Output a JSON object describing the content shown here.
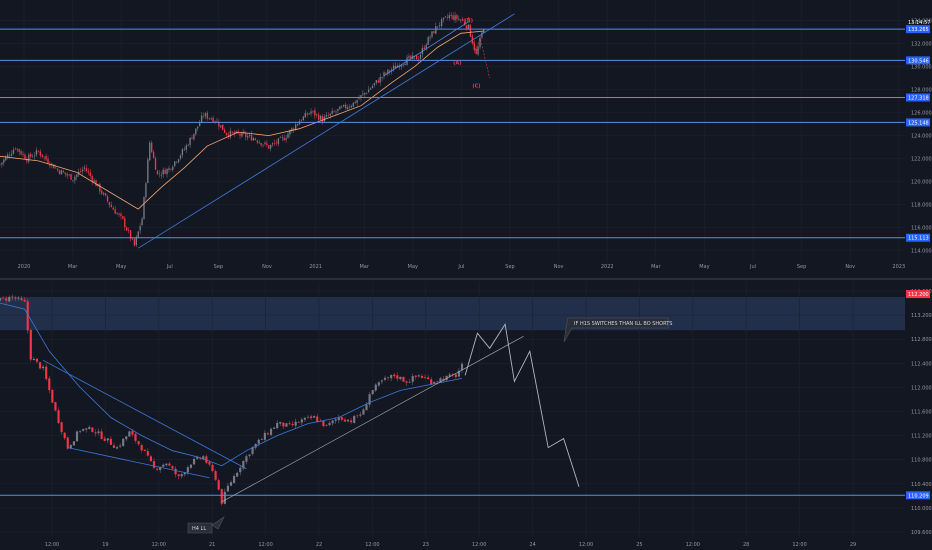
{
  "colors": {
    "background": "#131722",
    "grid": "#1e222d",
    "level_line": "#2962ff",
    "level_line_soft": "#5b8def",
    "badge_bg": "#2962ff",
    "up_candle": "#787b86",
    "down_candle": "#f23645",
    "ma_orange": "#f5a66e",
    "ma_blue": "#3d7bd9",
    "projection": "#b2b5be",
    "zone": "#2a3a5c",
    "price_badge_red": "#f23645"
  },
  "chart_data": [
    {
      "type": "candlestick",
      "panel": "top",
      "timeframe": "daily",
      "x_tick_labels": [
        "2020",
        "Mar",
        "May",
        "Jul",
        "Sep",
        "Nov",
        "2021",
        "Mar",
        "May",
        "Jul",
        "Sep",
        "Nov",
        "2022",
        "Mar",
        "May",
        "Jul",
        "Sep",
        "Nov",
        "2023"
      ],
      "y_tick_labels": [
        "114.000",
        "116.000",
        "118.000",
        "120.000",
        "122.000",
        "124.000",
        "126.000",
        "128.000",
        "130.000",
        "132.000",
        "134.000"
      ],
      "ylim": [
        113.0,
        135.8
      ],
      "current_price_label": "133.265",
      "countdown_label": "13:14:57",
      "horizontal_levels": [
        {
          "value": 133.265,
          "label": "133.265"
        },
        {
          "value": 130.546,
          "label": "130.546"
        },
        {
          "value": 127.318,
          "label": "127.318"
        },
        {
          "value": 125.148,
          "label": "125.148"
        },
        {
          "value": 115.113,
          "label": "115.113"
        }
      ],
      "wave_labels": [
        "(B)",
        "(A)",
        "(C)"
      ],
      "path_points": [
        {
          "x": 0,
          "y": 121.5
        },
        {
          "x": 8,
          "y": 123.0
        },
        {
          "x": 14,
          "y": 122.0
        },
        {
          "x": 20,
          "y": 122.6
        },
        {
          "x": 30,
          "y": 121.0
        },
        {
          "x": 38,
          "y": 120.3
        },
        {
          "x": 44,
          "y": 121.2
        },
        {
          "x": 52,
          "y": 119.3
        },
        {
          "x": 58,
          "y": 117.8
        },
        {
          "x": 64,
          "y": 116.6
        },
        {
          "x": 70,
          "y": 114.4
        },
        {
          "x": 74,
          "y": 116.8
        },
        {
          "x": 78,
          "y": 123.4
        },
        {
          "x": 82,
          "y": 120.6
        },
        {
          "x": 88,
          "y": 121.1
        },
        {
          "x": 96,
          "y": 122.8
        },
        {
          "x": 102,
          "y": 124.5
        },
        {
          "x": 106,
          "y": 125.8
        },
        {
          "x": 112,
          "y": 125.4
        },
        {
          "x": 118,
          "y": 124.2
        },
        {
          "x": 124,
          "y": 124.1
        },
        {
          "x": 132,
          "y": 123.8
        },
        {
          "x": 140,
          "y": 123.0
        },
        {
          "x": 148,
          "y": 123.8
        },
        {
          "x": 156,
          "y": 125.3
        },
        {
          "x": 162,
          "y": 126.1
        },
        {
          "x": 168,
          "y": 125.4
        },
        {
          "x": 176,
          "y": 126.2
        },
        {
          "x": 184,
          "y": 126.8
        },
        {
          "x": 192,
          "y": 128.0
        },
        {
          "x": 200,
          "y": 129.3
        },
        {
          "x": 206,
          "y": 130.0
        },
        {
          "x": 212,
          "y": 130.6
        },
        {
          "x": 218,
          "y": 130.8
        },
        {
          "x": 222,
          "y": 132.1
        },
        {
          "x": 228,
          "y": 133.6
        },
        {
          "x": 234,
          "y": 134.4
        },
        {
          "x": 240,
          "y": 134.1
        },
        {
          "x": 244,
          "y": 133.4
        },
        {
          "x": 248,
          "y": 131.0
        },
        {
          "x": 252,
          "y": 133.5
        }
      ],
      "moving_average": [
        {
          "x": 0,
          "y": 122.2
        },
        {
          "x": 20,
          "y": 121.8
        },
        {
          "x": 40,
          "y": 120.8
        },
        {
          "x": 60,
          "y": 118.8
        },
        {
          "x": 72,
          "y": 117.6
        },
        {
          "x": 84,
          "y": 119.5
        },
        {
          "x": 96,
          "y": 121.2
        },
        {
          "x": 108,
          "y": 123.1
        },
        {
          "x": 124,
          "y": 124.3
        },
        {
          "x": 140,
          "y": 124.0
        },
        {
          "x": 156,
          "y": 124.6
        },
        {
          "x": 172,
          "y": 125.6
        },
        {
          "x": 188,
          "y": 126.6
        },
        {
          "x": 204,
          "y": 128.6
        },
        {
          "x": 216,
          "y": 130.0
        },
        {
          "x": 228,
          "y": 131.7
        },
        {
          "x": 240,
          "y": 132.9
        },
        {
          "x": 252,
          "y": 133.1
        }
      ]
    },
    {
      "type": "candlestick",
      "panel": "bottom",
      "timeframe": "intraday",
      "x_tick_labels": [
        "12:00",
        "19",
        "12:00",
        "21",
        "12:00",
        "22",
        "12:00",
        "23",
        "12:00",
        "24",
        "12:00",
        "25",
        "12:00",
        "28",
        "12:00",
        "29"
      ],
      "y_tick_labels": [
        "109.600",
        "110.000",
        "110.400",
        "110.800",
        "111.200",
        "111.600",
        "112.000",
        "112.400",
        "112.800",
        "113.200",
        "113.600"
      ],
      "ylim": [
        109.5,
        113.75
      ],
      "current_price_label": "112.200",
      "support_level": {
        "value": 110.209,
        "label": "110.209"
      },
      "resistance_zone": [
        112.95,
        113.5
      ],
      "annotations": [
        {
          "text": "IF H1S SWITCHES THAN ILL BO SHORTS",
          "style": "callout"
        },
        {
          "text": "H4 LL",
          "style": "callout"
        }
      ],
      "path_points": [
        {
          "x": 0,
          "y": 113.45
        },
        {
          "x": 4,
          "y": 113.5
        },
        {
          "x": 8,
          "y": 113.4
        },
        {
          "x": 10,
          "y": 112.5
        },
        {
          "x": 14,
          "y": 112.3
        },
        {
          "x": 18,
          "y": 111.6
        },
        {
          "x": 22,
          "y": 111.0
        },
        {
          "x": 26,
          "y": 111.3
        },
        {
          "x": 30,
          "y": 111.3
        },
        {
          "x": 34,
          "y": 111.15
        },
        {
          "x": 38,
          "y": 111.0
        },
        {
          "x": 42,
          "y": 111.25
        },
        {
          "x": 46,
          "y": 111.0
        },
        {
          "x": 50,
          "y": 110.65
        },
        {
          "x": 54,
          "y": 110.75
        },
        {
          "x": 58,
          "y": 110.5
        },
        {
          "x": 62,
          "y": 110.75
        },
        {
          "x": 66,
          "y": 110.85
        },
        {
          "x": 70,
          "y": 110.5
        },
        {
          "x": 72,
          "y": 110.1
        },
        {
          "x": 74,
          "y": 110.35
        },
        {
          "x": 78,
          "y": 110.7
        },
        {
          "x": 82,
          "y": 111.0
        },
        {
          "x": 86,
          "y": 111.2
        },
        {
          "x": 90,
          "y": 111.4
        },
        {
          "x": 94,
          "y": 111.35
        },
        {
          "x": 98,
          "y": 111.45
        },
        {
          "x": 102,
          "y": 111.5
        },
        {
          "x": 106,
          "y": 111.35
        },
        {
          "x": 110,
          "y": 111.5
        },
        {
          "x": 114,
          "y": 111.45
        },
        {
          "x": 118,
          "y": 111.6
        },
        {
          "x": 120,
          "y": 111.9
        },
        {
          "x": 124,
          "y": 112.1
        },
        {
          "x": 128,
          "y": 112.2
        },
        {
          "x": 132,
          "y": 112.1
        },
        {
          "x": 136,
          "y": 112.2
        },
        {
          "x": 140,
          "y": 112.1
        },
        {
          "x": 144,
          "y": 112.15
        },
        {
          "x": 148,
          "y": 112.2
        },
        {
          "x": 150,
          "y": 112.35
        }
      ],
      "moving_average": [
        {
          "x": 0,
          "y": 113.4
        },
        {
          "x": 8,
          "y": 113.3
        },
        {
          "x": 16,
          "y": 112.6
        },
        {
          "x": 26,
          "y": 112.0
        },
        {
          "x": 36,
          "y": 111.5
        },
        {
          "x": 46,
          "y": 111.2
        },
        {
          "x": 56,
          "y": 110.95
        },
        {
          "x": 64,
          "y": 110.85
        },
        {
          "x": 72,
          "y": 110.7
        },
        {
          "x": 80,
          "y": 110.95
        },
        {
          "x": 90,
          "y": 111.2
        },
        {
          "x": 100,
          "y": 111.4
        },
        {
          "x": 110,
          "y": 111.5
        },
        {
          "x": 120,
          "y": 111.75
        },
        {
          "x": 130,
          "y": 111.95
        },
        {
          "x": 140,
          "y": 112.05
        },
        {
          "x": 150,
          "y": 112.15
        }
      ],
      "projection_path": [
        {
          "x": 151,
          "y": 112.2
        },
        {
          "x": 155,
          "y": 112.9
        },
        {
          "x": 159,
          "y": 112.65
        },
        {
          "x": 164,
          "y": 113.05
        },
        {
          "x": 167,
          "y": 112.1
        },
        {
          "x": 172,
          "y": 112.6
        },
        {
          "x": 178,
          "y": 111.0
        },
        {
          "x": 183,
          "y": 111.15
        },
        {
          "x": 188,
          "y": 110.35
        }
      ]
    }
  ]
}
